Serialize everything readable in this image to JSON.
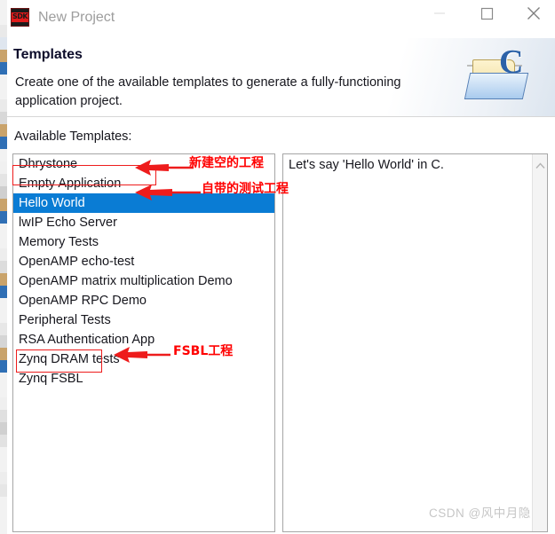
{
  "window": {
    "title": "New Project",
    "icon_name": "sdk-icon",
    "icon_label": "SDK",
    "controls": {
      "minimize": "minimize-icon",
      "maximize": "maximize-icon",
      "close": "close-icon"
    }
  },
  "header": {
    "title": "Templates",
    "description": "Create one of the available templates to generate a fully-functioning application project.",
    "icon_name": "c-project-folder-icon",
    "icon_letter": "C"
  },
  "content": {
    "available_label": "Available Templates:",
    "templates": [
      {
        "label": "Dhrystone",
        "selected": false
      },
      {
        "label": "Empty Application",
        "selected": false
      },
      {
        "label": "Hello World",
        "selected": true
      },
      {
        "label": "lwIP Echo Server",
        "selected": false
      },
      {
        "label": "Memory Tests",
        "selected": false
      },
      {
        "label": "OpenAMP echo-test",
        "selected": false
      },
      {
        "label": "OpenAMP matrix multiplication Demo",
        "selected": false
      },
      {
        "label": "OpenAMP RPC Demo",
        "selected": false
      },
      {
        "label": "Peripheral Tests",
        "selected": false
      },
      {
        "label": "RSA Authentication App",
        "selected": false
      },
      {
        "label": "Zynq DRAM tests",
        "selected": false
      },
      {
        "label": "Zynq FSBL",
        "selected": false
      }
    ],
    "description_panel": {
      "text": "Let's say 'Hello World' in C.",
      "scroll_up_icon": "chevron-up-icon"
    }
  },
  "annotations": {
    "color": "#ff0000",
    "items": [
      {
        "text": "新建空的工程",
        "target": "Empty Application"
      },
      {
        "text": "自带的测试工程",
        "target": "Hello World"
      },
      {
        "text": "FSBL工程",
        "target": "Zynq FSBL"
      }
    ]
  },
  "watermark": {
    "text": "CSDN @风中月隐"
  }
}
